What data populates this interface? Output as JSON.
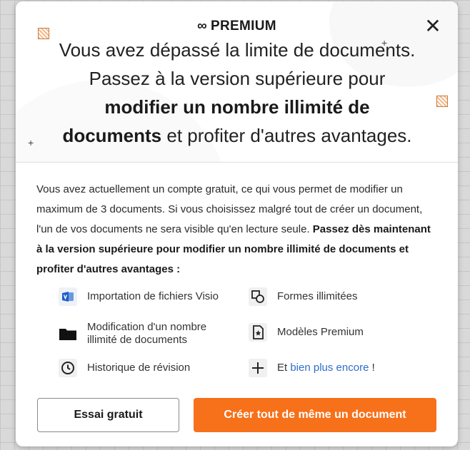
{
  "header": {
    "badge_label": "PREMIUM",
    "badge_icon": "infinity-icon",
    "headline_line1": "Vous avez dépassé la limite de documents.",
    "headline_line2": "Passez à la version supérieure pour",
    "headline_bold1": "modifier un nombre illimité de",
    "headline_bold2": "documents",
    "headline_rest": " et profiter d'autres avantages.",
    "close_symbol": "✕"
  },
  "body": {
    "description_normal": "Vous avez actuellement un compte gratuit, ce qui vous permet de modifier un maximum de 3 documents. Si vous choisissez malgré tout de créer un document, l'un de vos documents ne sera visible qu'en lecture seule. ",
    "description_bold": "Passez dès maintenant à la version supérieure pour modifier un nombre illimité de documents et profiter d'autres avantages :"
  },
  "features": {
    "visio": "Importation de fichiers Visio",
    "shapes": "Formes illimitées",
    "unlimited_docs": "Modification d'un nombre illimité de documents",
    "templates": "Modèles Premium",
    "history": "Historique de révision",
    "more_prefix": "Et ",
    "more_link": "bien plus encore",
    "more_suffix": " !"
  },
  "buttons": {
    "trial": "Essai gratuit",
    "create": "Créer tout de même un document"
  },
  "colors": {
    "accent_orange": "#f7701a",
    "link_blue": "#2d6ecb",
    "visio_blue": "#1f5fc4"
  }
}
